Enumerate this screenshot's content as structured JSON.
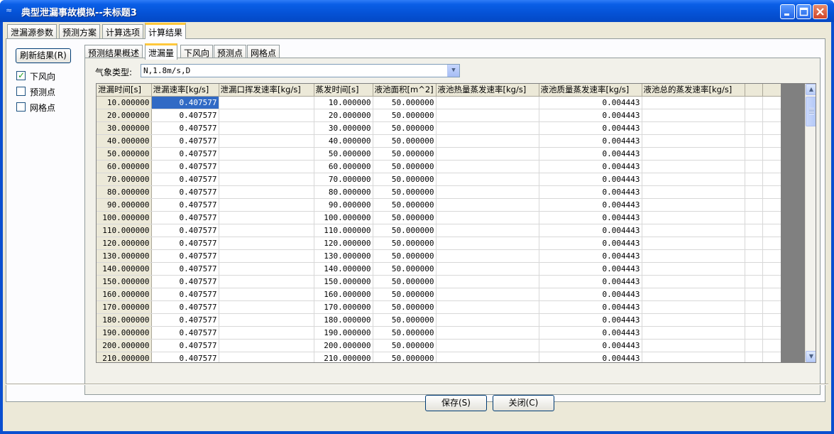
{
  "window": {
    "title": "典型泄漏事故模拟--未标题3",
    "icon": "app-icon"
  },
  "main_tabs": [
    {
      "label": "泄漏源参数",
      "active": false
    },
    {
      "label": "预测方案",
      "active": false
    },
    {
      "label": "计算选项",
      "active": false
    },
    {
      "label": "计算结果",
      "active": true
    }
  ],
  "left_panel": {
    "refresh_label": "刷新结果(R)",
    "checkboxes": [
      {
        "label": "下风向",
        "checked": true
      },
      {
        "label": "预测点",
        "checked": false
      },
      {
        "label": "网格点",
        "checked": false
      }
    ]
  },
  "sub_tabs": [
    {
      "label": "预测结果概述",
      "active": false
    },
    {
      "label": "泄漏量",
      "active": true
    },
    {
      "label": "下风向",
      "active": false
    },
    {
      "label": "预测点",
      "active": false
    },
    {
      "label": "网格点",
      "active": false
    }
  ],
  "weather": {
    "label": "气象类型:",
    "value": "N,1.8m/s,D"
  },
  "grid": {
    "columns": [
      "泄漏时间[s]",
      "泄漏速率[kg/s]",
      "泄漏口挥发速率[kg/s]",
      "蒸发时间[s]",
      "液池面积[m^2]",
      "液池热量蒸发速率[kg/s]",
      "液池质量蒸发速率[kg/s]",
      "液池总的蒸发速率[kg/s]",
      "",
      ""
    ],
    "rows": [
      [
        "10.000000",
        "0.407577",
        "",
        "10.000000",
        "50.000000",
        "",
        "0.004443",
        "",
        "",
        ""
      ],
      [
        "20.000000",
        "0.407577",
        "",
        "20.000000",
        "50.000000",
        "",
        "0.004443",
        "",
        "",
        ""
      ],
      [
        "30.000000",
        "0.407577",
        "",
        "30.000000",
        "50.000000",
        "",
        "0.004443",
        "",
        "",
        ""
      ],
      [
        "40.000000",
        "0.407577",
        "",
        "40.000000",
        "50.000000",
        "",
        "0.004443",
        "",
        "",
        ""
      ],
      [
        "50.000000",
        "0.407577",
        "",
        "50.000000",
        "50.000000",
        "",
        "0.004443",
        "",
        "",
        ""
      ],
      [
        "60.000000",
        "0.407577",
        "",
        "60.000000",
        "50.000000",
        "",
        "0.004443",
        "",
        "",
        ""
      ],
      [
        "70.000000",
        "0.407577",
        "",
        "70.000000",
        "50.000000",
        "",
        "0.004443",
        "",
        "",
        ""
      ],
      [
        "80.000000",
        "0.407577",
        "",
        "80.000000",
        "50.000000",
        "",
        "0.004443",
        "",
        "",
        ""
      ],
      [
        "90.000000",
        "0.407577",
        "",
        "90.000000",
        "50.000000",
        "",
        "0.004443",
        "",
        "",
        ""
      ],
      [
        "100.000000",
        "0.407577",
        "",
        "100.000000",
        "50.000000",
        "",
        "0.004443",
        "",
        "",
        ""
      ],
      [
        "110.000000",
        "0.407577",
        "",
        "110.000000",
        "50.000000",
        "",
        "0.004443",
        "",
        "",
        ""
      ],
      [
        "120.000000",
        "0.407577",
        "",
        "120.000000",
        "50.000000",
        "",
        "0.004443",
        "",
        "",
        ""
      ],
      [
        "130.000000",
        "0.407577",
        "",
        "130.000000",
        "50.000000",
        "",
        "0.004443",
        "",
        "",
        ""
      ],
      [
        "140.000000",
        "0.407577",
        "",
        "140.000000",
        "50.000000",
        "",
        "0.004443",
        "",
        "",
        ""
      ],
      [
        "150.000000",
        "0.407577",
        "",
        "150.000000",
        "50.000000",
        "",
        "0.004443",
        "",
        "",
        ""
      ],
      [
        "160.000000",
        "0.407577",
        "",
        "160.000000",
        "50.000000",
        "",
        "0.004443",
        "",
        "",
        ""
      ],
      [
        "170.000000",
        "0.407577",
        "",
        "170.000000",
        "50.000000",
        "",
        "0.004443",
        "",
        "",
        ""
      ],
      [
        "180.000000",
        "0.407577",
        "",
        "180.000000",
        "50.000000",
        "",
        "0.004443",
        "",
        "",
        ""
      ],
      [
        "190.000000",
        "0.407577",
        "",
        "190.000000",
        "50.000000",
        "",
        "0.004443",
        "",
        "",
        ""
      ],
      [
        "200.000000",
        "0.407577",
        "",
        "200.000000",
        "50.000000",
        "",
        "0.004443",
        "",
        "",
        ""
      ],
      [
        "210.000000",
        "0.407577",
        "",
        "210.000000",
        "50.000000",
        "",
        "0.004443",
        "",
        "",
        ""
      ]
    ],
    "selected_cell": {
      "row": 0,
      "col": 1
    }
  },
  "buttons": {
    "save": "保存(S)",
    "close": "关闭(C)"
  },
  "colors": {
    "titlebar": "#0552d6",
    "selection": "#316ac5",
    "active_tab_accent": "#ffc83c"
  }
}
